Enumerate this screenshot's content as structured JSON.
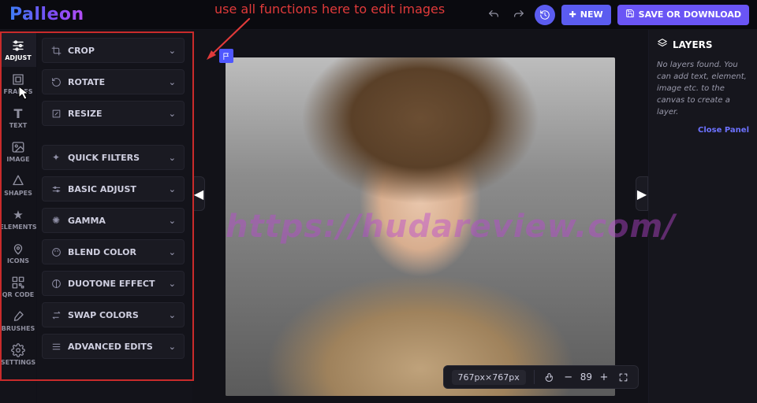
{
  "brand": "Palleon",
  "top": {
    "new": "NEW",
    "save": "SAVE OR DOWNLOAD"
  },
  "rail": {
    "items": [
      {
        "id": "adjust",
        "label": "ADJUST"
      },
      {
        "id": "frames",
        "label": "FRAMES"
      },
      {
        "id": "text",
        "label": "TEXT"
      },
      {
        "id": "image",
        "label": "IMAGE"
      },
      {
        "id": "shapes",
        "label": "SHAPES"
      },
      {
        "id": "elements",
        "label": "ELEMENTS"
      },
      {
        "id": "icons",
        "label": "ICONS"
      },
      {
        "id": "qrcode",
        "label": "QR CODE"
      },
      {
        "id": "brushes",
        "label": "BRUSHES"
      },
      {
        "id": "settings",
        "label": "SETTINGS"
      }
    ]
  },
  "adjustPanel": {
    "group1": [
      {
        "id": "crop",
        "label": "CROP"
      },
      {
        "id": "rotate",
        "label": "ROTATE"
      },
      {
        "id": "resize",
        "label": "RESIZE"
      }
    ],
    "group2": [
      {
        "id": "quick",
        "label": "QUICK FILTERS"
      },
      {
        "id": "basic",
        "label": "BASIC ADJUST"
      },
      {
        "id": "gamma",
        "label": "GAMMA"
      },
      {
        "id": "blend",
        "label": "BLEND COLOR"
      },
      {
        "id": "duotone",
        "label": "DUOTONE EFFECT"
      },
      {
        "id": "swap",
        "label": "SWAP COLORS"
      },
      {
        "id": "advanced",
        "label": "ADVANCED EDITS"
      }
    ]
  },
  "canvas": {
    "dimensions": "767px×767px",
    "zoom": "89",
    "watermark": "https://hudareview.com/"
  },
  "layers": {
    "title": "LAYERS",
    "empty": "No layers found. You can add text, element, image etc. to the canvas to create a layer.",
    "close": "Close Panel"
  },
  "annotation": "use all functions here to edit images",
  "colors": {
    "accent": "#5b5cf0",
    "highlight": "#c92b2b",
    "link": "#6d72ff"
  }
}
